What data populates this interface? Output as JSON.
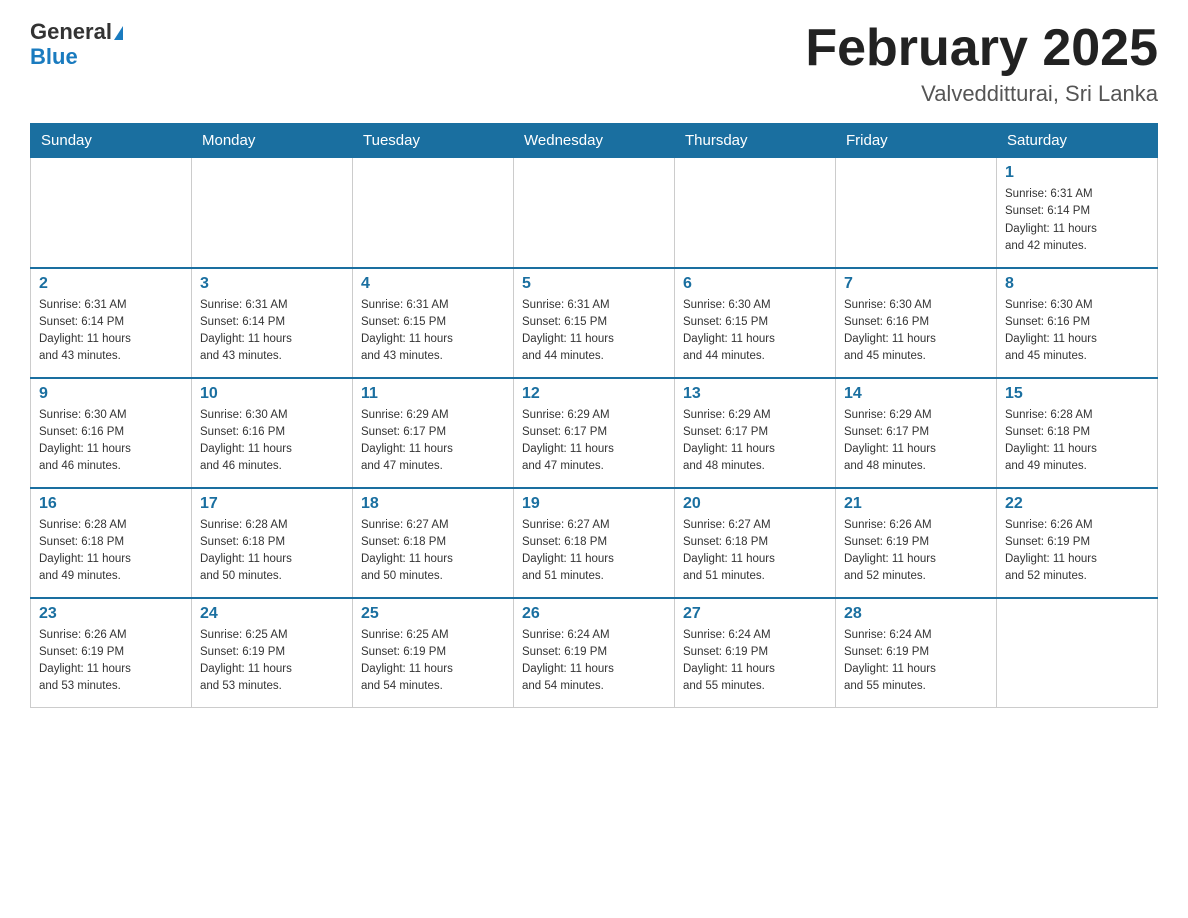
{
  "logo": {
    "part1": "General",
    "part2": "Blue"
  },
  "title": "February 2025",
  "location": "Valvedditturai, Sri Lanka",
  "days_of_week": [
    "Sunday",
    "Monday",
    "Tuesday",
    "Wednesday",
    "Thursday",
    "Friday",
    "Saturday"
  ],
  "weeks": [
    [
      {
        "day": "",
        "info": ""
      },
      {
        "day": "",
        "info": ""
      },
      {
        "day": "",
        "info": ""
      },
      {
        "day": "",
        "info": ""
      },
      {
        "day": "",
        "info": ""
      },
      {
        "day": "",
        "info": ""
      },
      {
        "day": "1",
        "info": "Sunrise: 6:31 AM\nSunset: 6:14 PM\nDaylight: 11 hours\nand 42 minutes."
      }
    ],
    [
      {
        "day": "2",
        "info": "Sunrise: 6:31 AM\nSunset: 6:14 PM\nDaylight: 11 hours\nand 43 minutes."
      },
      {
        "day": "3",
        "info": "Sunrise: 6:31 AM\nSunset: 6:14 PM\nDaylight: 11 hours\nand 43 minutes."
      },
      {
        "day": "4",
        "info": "Sunrise: 6:31 AM\nSunset: 6:15 PM\nDaylight: 11 hours\nand 43 minutes."
      },
      {
        "day": "5",
        "info": "Sunrise: 6:31 AM\nSunset: 6:15 PM\nDaylight: 11 hours\nand 44 minutes."
      },
      {
        "day": "6",
        "info": "Sunrise: 6:30 AM\nSunset: 6:15 PM\nDaylight: 11 hours\nand 44 minutes."
      },
      {
        "day": "7",
        "info": "Sunrise: 6:30 AM\nSunset: 6:16 PM\nDaylight: 11 hours\nand 45 minutes."
      },
      {
        "day": "8",
        "info": "Sunrise: 6:30 AM\nSunset: 6:16 PM\nDaylight: 11 hours\nand 45 minutes."
      }
    ],
    [
      {
        "day": "9",
        "info": "Sunrise: 6:30 AM\nSunset: 6:16 PM\nDaylight: 11 hours\nand 46 minutes."
      },
      {
        "day": "10",
        "info": "Sunrise: 6:30 AM\nSunset: 6:16 PM\nDaylight: 11 hours\nand 46 minutes."
      },
      {
        "day": "11",
        "info": "Sunrise: 6:29 AM\nSunset: 6:17 PM\nDaylight: 11 hours\nand 47 minutes."
      },
      {
        "day": "12",
        "info": "Sunrise: 6:29 AM\nSunset: 6:17 PM\nDaylight: 11 hours\nand 47 minutes."
      },
      {
        "day": "13",
        "info": "Sunrise: 6:29 AM\nSunset: 6:17 PM\nDaylight: 11 hours\nand 48 minutes."
      },
      {
        "day": "14",
        "info": "Sunrise: 6:29 AM\nSunset: 6:17 PM\nDaylight: 11 hours\nand 48 minutes."
      },
      {
        "day": "15",
        "info": "Sunrise: 6:28 AM\nSunset: 6:18 PM\nDaylight: 11 hours\nand 49 minutes."
      }
    ],
    [
      {
        "day": "16",
        "info": "Sunrise: 6:28 AM\nSunset: 6:18 PM\nDaylight: 11 hours\nand 49 minutes."
      },
      {
        "day": "17",
        "info": "Sunrise: 6:28 AM\nSunset: 6:18 PM\nDaylight: 11 hours\nand 50 minutes."
      },
      {
        "day": "18",
        "info": "Sunrise: 6:27 AM\nSunset: 6:18 PM\nDaylight: 11 hours\nand 50 minutes."
      },
      {
        "day": "19",
        "info": "Sunrise: 6:27 AM\nSunset: 6:18 PM\nDaylight: 11 hours\nand 51 minutes."
      },
      {
        "day": "20",
        "info": "Sunrise: 6:27 AM\nSunset: 6:18 PM\nDaylight: 11 hours\nand 51 minutes."
      },
      {
        "day": "21",
        "info": "Sunrise: 6:26 AM\nSunset: 6:19 PM\nDaylight: 11 hours\nand 52 minutes."
      },
      {
        "day": "22",
        "info": "Sunrise: 6:26 AM\nSunset: 6:19 PM\nDaylight: 11 hours\nand 52 minutes."
      }
    ],
    [
      {
        "day": "23",
        "info": "Sunrise: 6:26 AM\nSunset: 6:19 PM\nDaylight: 11 hours\nand 53 minutes."
      },
      {
        "day": "24",
        "info": "Sunrise: 6:25 AM\nSunset: 6:19 PM\nDaylight: 11 hours\nand 53 minutes."
      },
      {
        "day": "25",
        "info": "Sunrise: 6:25 AM\nSunset: 6:19 PM\nDaylight: 11 hours\nand 54 minutes."
      },
      {
        "day": "26",
        "info": "Sunrise: 6:24 AM\nSunset: 6:19 PM\nDaylight: 11 hours\nand 54 minutes."
      },
      {
        "day": "27",
        "info": "Sunrise: 6:24 AM\nSunset: 6:19 PM\nDaylight: 11 hours\nand 55 minutes."
      },
      {
        "day": "28",
        "info": "Sunrise: 6:24 AM\nSunset: 6:19 PM\nDaylight: 11 hours\nand 55 minutes."
      },
      {
        "day": "",
        "info": ""
      }
    ]
  ]
}
